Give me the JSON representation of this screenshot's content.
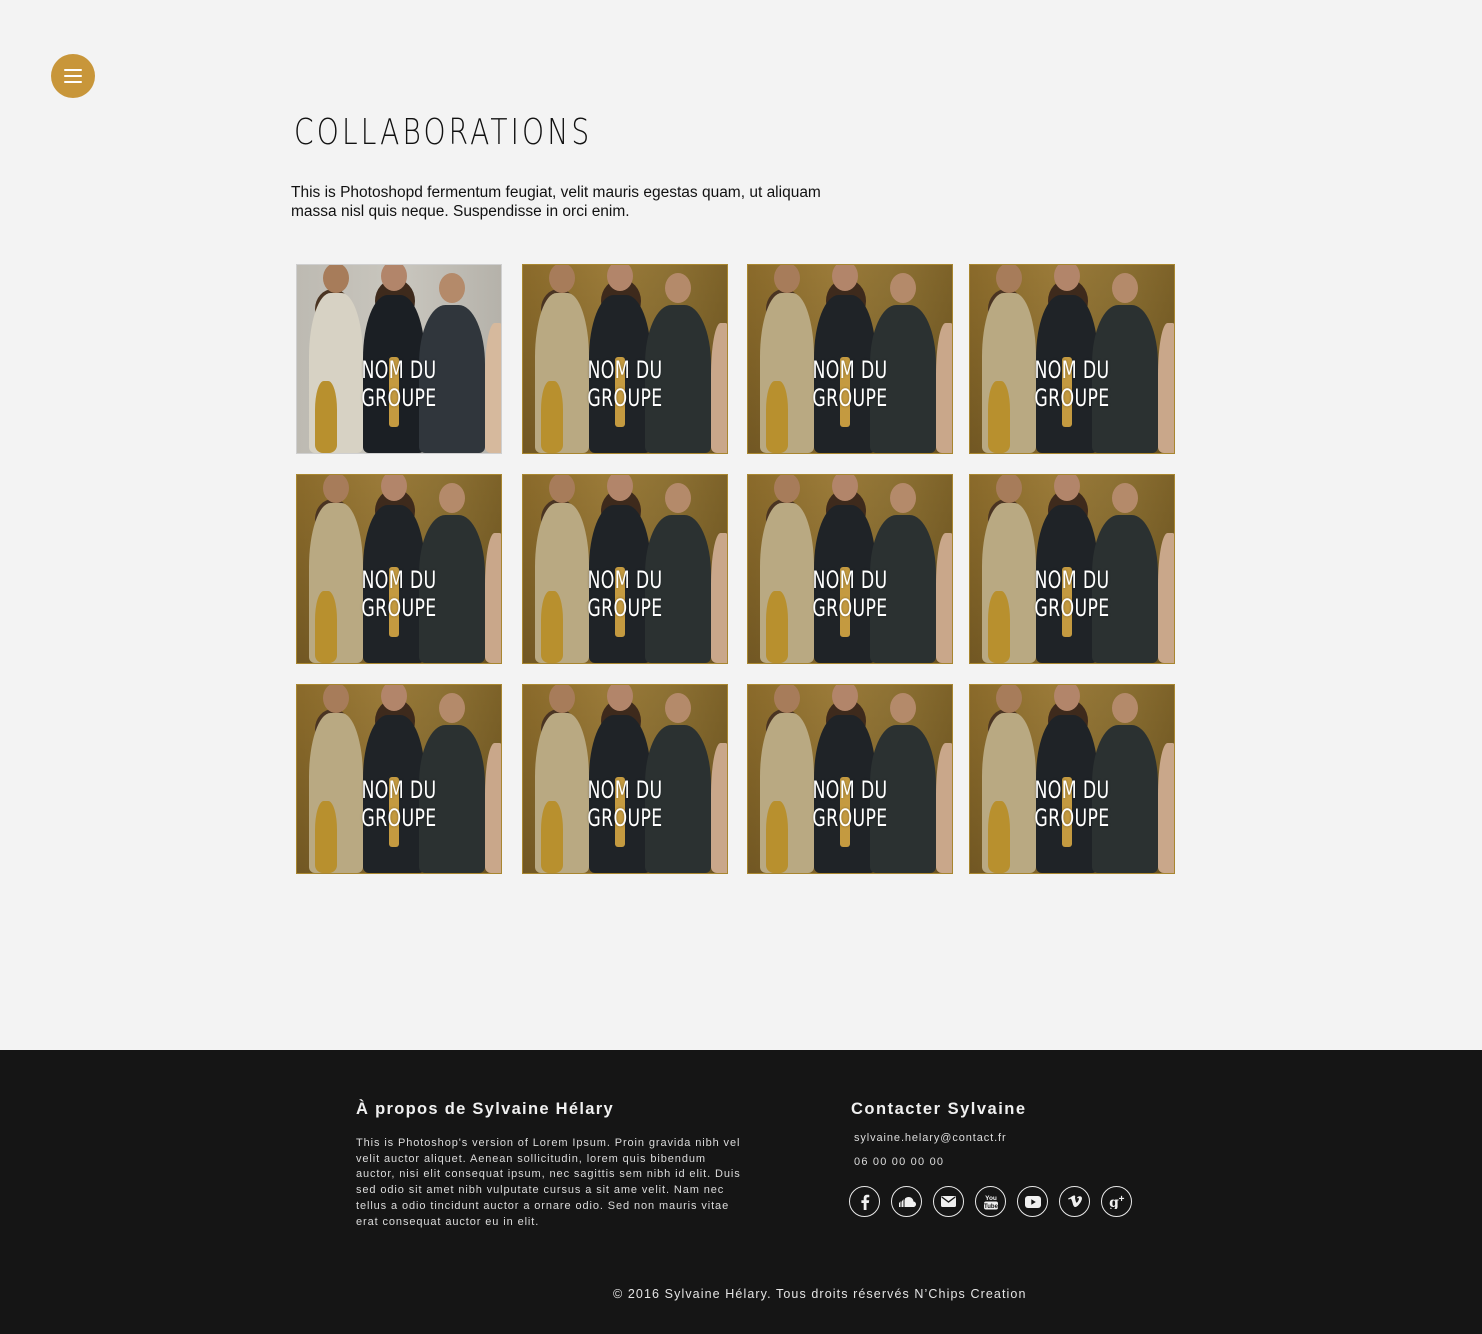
{
  "menu": {
    "icon": "hamburger-menu-icon"
  },
  "main": {
    "title": "COLLABORATIONS",
    "intro": "This is Photoshopd fermentum feugiat, velit mauris egestas quam, ut aliquam massa nisl quis neque. Suspendisse in orci enim.",
    "groups": [
      {
        "label": "NOM DU GROUPE"
      },
      {
        "label": "NOM DU GROUPE"
      },
      {
        "label": "NOM DU GROUPE"
      },
      {
        "label": "NOM DU GROUPE"
      },
      {
        "label": "NOM DU GROUPE"
      },
      {
        "label": "NOM DU GROUPE"
      },
      {
        "label": "NOM DU GROUPE"
      },
      {
        "label": "NOM DU GROUPE"
      },
      {
        "label": "NOM DU GROUPE"
      },
      {
        "label": "NOM DU GROUPE"
      },
      {
        "label": "NOM DU GROUPE"
      },
      {
        "label": "NOM DU GROUPE"
      }
    ]
  },
  "footer": {
    "about_title": "À propos de Sylvaine Hélary",
    "about_text": "This is Photoshop's version  of Lorem Ipsum. Proin gravida nibh vel velit auctor aliquet. Aenean sollicitudin, lorem quis bibendum auctor, nisi elit consequat ipsum, nec sagittis sem nibh id elit. Duis sed odio sit amet nibh vulputate cursus a sit ame velit. Nam nec tellus a odio tincidunt auctor a ornare odio. Sed non mauris vitae erat consequat auctor eu in elit.",
    "contact_title": "Contacter Sylvaine",
    "email": "sylvaine.helary@contact.fr",
    "phone": "06 00 00 00 00",
    "socials": [
      "facebook-icon",
      "soundcloud-icon",
      "email-icon",
      "youtube-logo-icon",
      "youtube-play-icon",
      "vimeo-icon",
      "google-plus-icon"
    ],
    "copyright": "© 2016 Sylvaine Hélary. Tous droits réservés N’Chips Creation"
  },
  "colors": {
    "accent": "#c8963a",
    "background": "#f3f3f3",
    "footer_bg": "#151515"
  }
}
